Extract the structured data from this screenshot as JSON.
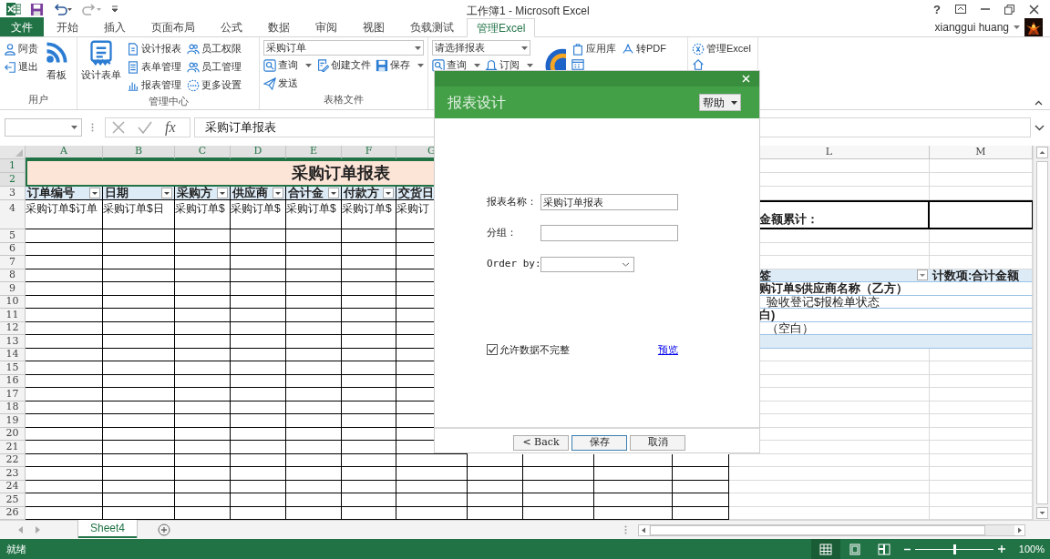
{
  "title_bar": {
    "title": "工作簿1 - Microsoft Excel",
    "help": "?",
    "user": "xianggui huang"
  },
  "tabs": [
    {
      "label": "文件",
      "kind": "file",
      "selected": false
    },
    {
      "label": "开始",
      "kind": "tab",
      "selected": false
    },
    {
      "label": "插入",
      "kind": "tab",
      "selected": false
    },
    {
      "label": "页面布局",
      "kind": "tab",
      "selected": false
    },
    {
      "label": "公式",
      "kind": "tab",
      "selected": false
    },
    {
      "label": "数据",
      "kind": "tab",
      "selected": false
    },
    {
      "label": "审阅",
      "kind": "tab",
      "selected": false
    },
    {
      "label": "视图",
      "kind": "tab",
      "selected": false
    },
    {
      "label": "负载测试",
      "kind": "tab",
      "selected": false
    },
    {
      "label": "管理Excel",
      "kind": "tab",
      "selected": true
    }
  ],
  "ribbon": [
    {
      "label": "用户",
      "columns": [
        [
          [
            {
              "kind": "small",
              "label": "阿贵"
            }
          ],
          [
            {
              "kind": "small",
              "label": "退出"
            }
          ]
        ],
        [
          [
            {
              "kind": "large",
              "label": "看板"
            }
          ]
        ]
      ]
    },
    {
      "label": "管理中心",
      "columns": [
        [
          [
            {
              "kind": "large",
              "label": "设计表单"
            }
          ]
        ],
        [
          [
            {
              "kind": "small",
              "label": "设计报表"
            }
          ],
          [
            {
              "kind": "small",
              "label": "表单管理"
            }
          ],
          [
            {
              "kind": "small",
              "label": "报表管理"
            }
          ]
        ],
        [
          [
            {
              "kind": "small",
              "label": "员工权限"
            }
          ],
          [
            {
              "kind": "small",
              "label": "员工管理"
            }
          ],
          [
            {
              "kind": "small",
              "label": "更多设置"
            }
          ]
        ]
      ]
    },
    {
      "label": "表格文件",
      "columns": [
        [
          [
            {
              "kind": "combo",
              "value": "采购订单"
            }
          ],
          [
            {
              "kind": "split",
              "label": "查询"
            },
            {
              "kind": "small",
              "label": "创建文件"
            },
            {
              "kind": "split",
              "label": "保存"
            }
          ],
          [
            {
              "kind": "small",
              "label": "发送"
            }
          ]
        ]
      ]
    },
    {
      "columns": [
        [
          [
            {
              "kind": "combo",
              "value": "请选择报表"
            }
          ],
          [
            {
              "kind": "split",
              "label": "查询"
            },
            {
              "kind": "split",
              "label": "订阅"
            }
          ]
        ],
        [
          [
            {
              "kind": "icon"
            }
          ]
        ],
        [
          [
            {
              "kind": "small",
              "label": "应用库"
            }
          ],
          [
            {
              "kind": "small_icon"
            }
          ]
        ],
        [
          [
            {
              "kind": "small",
              "label": "转PDF"
            }
          ]
        ]
      ]
    },
    {
      "columns": [
        [
          [
            {
              "kind": "small",
              "label": "管理Excel"
            }
          ],
          [
            {
              "kind": "small_icon"
            }
          ]
        ]
      ]
    }
  ],
  "formula_bar": {
    "function_label": "fx",
    "formula": "采购订单报表"
  },
  "sheet": {
    "columns": [
      "A",
      "B",
      "C",
      "D",
      "E",
      "F",
      "G",
      "L",
      "M"
    ],
    "rows": [
      "1",
      "2",
      "3",
      "4",
      "5",
      "6",
      "7",
      "8",
      "9",
      "10",
      "11",
      "12",
      "13",
      "14",
      "15",
      "16",
      "17",
      "18",
      "19",
      "20",
      "21",
      "22",
      "23",
      "24",
      "25",
      "26"
    ],
    "title": "采购订单报表",
    "headers": [
      {
        "text": "订单编号",
        "filter": true
      },
      {
        "text": "日期",
        "filter": true
      },
      {
        "text": "采购方",
        "filter": true
      },
      {
        "text": "供应商",
        "filter": true
      },
      {
        "text": "合计金",
        "filter": true
      },
      {
        "text": "付款方",
        "filter": true
      },
      {
        "text": "交货日"
      }
    ],
    "data": [
      "采购订单$订单",
      "采购订单$日",
      "采购订单$",
      "采购订单$",
      "采购订单$",
      "采购订单$",
      "采购订"
    ],
    "total_label": "金额累计：",
    "pivot": [
      {
        "kind": "header",
        "text": "签",
        "value": "计数项:合计金额"
      },
      {
        "kind": "bold",
        "text": "购订单$供应商名称（乙方）"
      },
      {
        "kind": "indent",
        "text": "验收登记$报检单状态"
      },
      {
        "kind": "bold",
        "text": "白)"
      },
      {
        "kind": "indent",
        "text": "（空白）"
      },
      {
        "kind": "band"
      }
    ]
  },
  "dialog": {
    "title": "报表设计",
    "help": "帮助",
    "fields": [
      {
        "kind": "text",
        "label": "报表名称：",
        "value": "采购订单报表"
      },
      {
        "kind": "text",
        "label": "分组："
      },
      {
        "kind": "select",
        "label": "Order by:"
      }
    ],
    "checkbox": {
      "label": "允许数据不完整",
      "checked": true
    },
    "link": "预览",
    "buttons": [
      {
        "label": "< Back",
        "default": false
      },
      {
        "label": "保存",
        "default": true
      },
      {
        "label": "取消",
        "default": false
      }
    ]
  },
  "sheet_tabs": [
    {
      "label": "Sheet4",
      "selected": true
    }
  ],
  "status_bar": {
    "status": "就绪",
    "views": [
      {
        "kind": "normal",
        "selected": true
      },
      {
        "kind": "page_layout",
        "selected": false
      },
      {
        "kind": "page_break",
        "selected": false
      }
    ],
    "zoom": {
      "level": 0.5,
      "reading": "100%"
    }
  }
}
